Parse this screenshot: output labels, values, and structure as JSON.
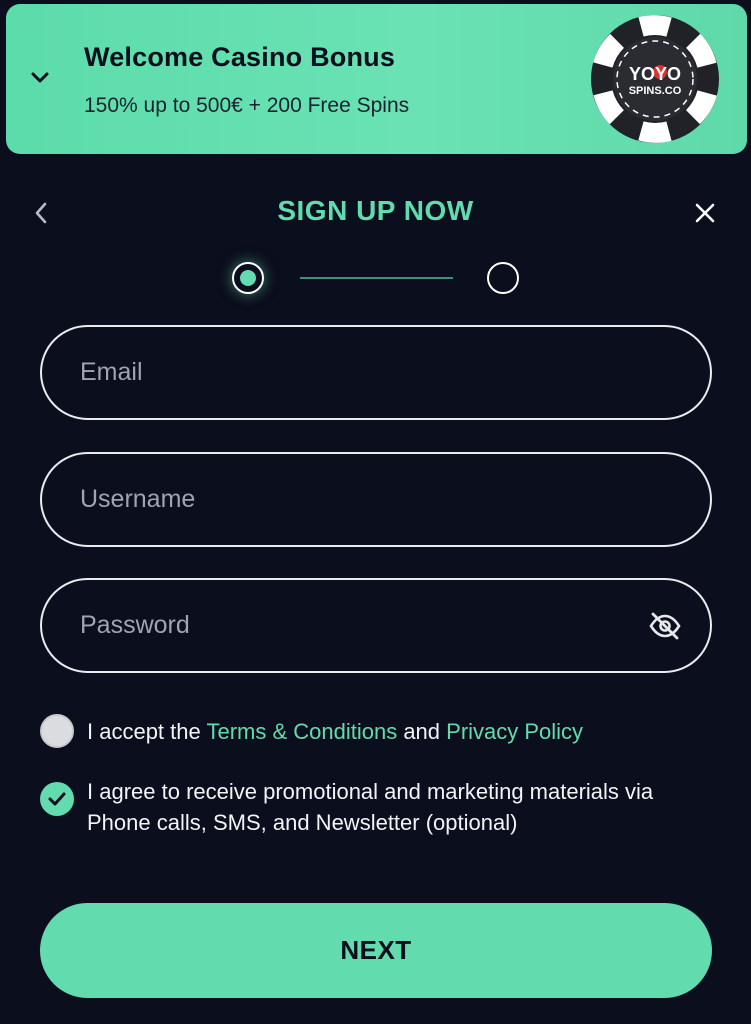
{
  "banner": {
    "title": "Welcome Casino Bonus",
    "subtitle": "150% up to 500€ + 200 Free Spins",
    "logo_line1": "YOYO",
    "logo_line2": "SPINS.CO"
  },
  "header": {
    "title": "SIGN UP NOW"
  },
  "stepper": {
    "current_step": 1,
    "total_steps": 2
  },
  "form": {
    "email_placeholder": "Email",
    "email_value": "",
    "username_placeholder": "Username",
    "username_value": "",
    "password_placeholder": "Password",
    "password_value": ""
  },
  "terms": {
    "prefix": "I accept the ",
    "terms_link": "Terms & Conditions",
    "middle": " and ",
    "privacy_link": "Privacy Policy",
    "checked": false
  },
  "marketing": {
    "text": "I agree to receive promotional and marketing materials via Phone calls, SMS, and Newsletter (optional)",
    "checked": true
  },
  "next_button": {
    "label": "NEXT"
  },
  "icons": {
    "banner_toggle": "chevron-down-icon",
    "back": "chevron-left-icon",
    "close": "close-icon",
    "password_toggle": "eye-off-icon",
    "check": "checkmark-icon"
  },
  "colors": {
    "background": "#0b0e1c",
    "accent": "#62dcae",
    "banner": "#5cdcaa",
    "logo_red": "#e0302d"
  }
}
